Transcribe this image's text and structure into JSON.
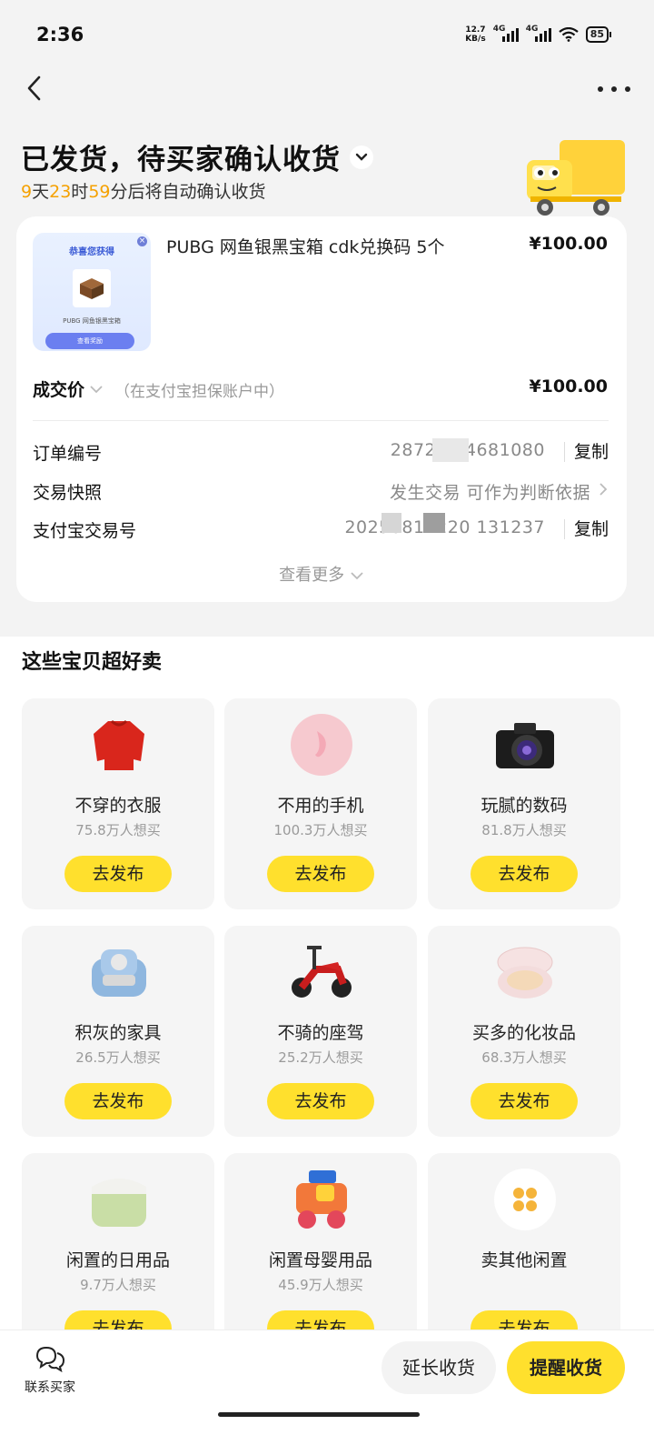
{
  "status_bar": {
    "time": "2:36",
    "net_speed_value": "12.7",
    "net_speed_unit": "KB/s",
    "signal1_label": "4G",
    "signal2_label": "4G",
    "battery": "85"
  },
  "header": {
    "status_title": "已发货，待买家确认收货",
    "countdown": {
      "days": "9",
      "days_unit": "天",
      "hours": "23",
      "hours_unit": "时",
      "minutes": "59",
      "suffix": "分后将自动确认收货"
    }
  },
  "order": {
    "thumbnail": {
      "title": "恭喜您获得",
      "caption": "PUBG 网鱼银黑宝箱",
      "button": "查看奖励"
    },
    "item_title": "PUBG 网鱼银黑宝箱 cdk兑换码 5个",
    "item_price": "¥100.00",
    "deal_label": "成交价",
    "deal_note": "（在支付宝担保账户中）",
    "deal_price": "¥100.00",
    "rows": [
      {
        "label": "订单编号",
        "value": "287272            4681080",
        "action": "复制"
      },
      {
        "label": "交易快照",
        "value": "发生交易           可作为判断依据",
        "action": ""
      },
      {
        "label": "支付宝交易号",
        "value": "20250811220               131237",
        "action": "复制"
      }
    ],
    "view_more": "查看更多"
  },
  "suggestions": {
    "title": "这些宝贝超好卖",
    "items": [
      {
        "name": "不穿的衣服",
        "want": "75.8万人想买",
        "button": "去发布",
        "icon": "sweater-icon"
      },
      {
        "name": "不用的手机",
        "want": "100.3万人想买",
        "button": "去发布",
        "icon": "phone-icon"
      },
      {
        "name": "玩腻的数码",
        "want": "81.8万人想买",
        "button": "去发布",
        "icon": "camera-icon"
      },
      {
        "name": "积灰的家具",
        "want": "26.5万人想买",
        "button": "去发布",
        "icon": "sofa-icon"
      },
      {
        "name": "不骑的座驾",
        "want": "25.2万人想买",
        "button": "去发布",
        "icon": "scooter-icon"
      },
      {
        "name": "买多的化妆品",
        "want": "68.3万人想买",
        "button": "去发布",
        "icon": "cushion-compact-icon"
      },
      {
        "name": "闲置的日用品",
        "want": "9.7万人想买",
        "button": "去发布",
        "icon": "storage-box-icon"
      },
      {
        "name": "闲置母婴用品",
        "want": "45.9万人想买",
        "button": "去发布",
        "icon": "toy-blocks-icon"
      },
      {
        "name": "卖其他闲置",
        "want": "",
        "button": "去发布",
        "icon": "grid-dots-icon"
      }
    ]
  },
  "bottom_bar": {
    "contact": "联系买家",
    "extend": "延长收货",
    "remind": "提醒收货"
  },
  "colors": {
    "accent_yellow": "#ffe02d",
    "countdown_orange": "#f5a100",
    "background_gray": "#f3f3f3"
  }
}
